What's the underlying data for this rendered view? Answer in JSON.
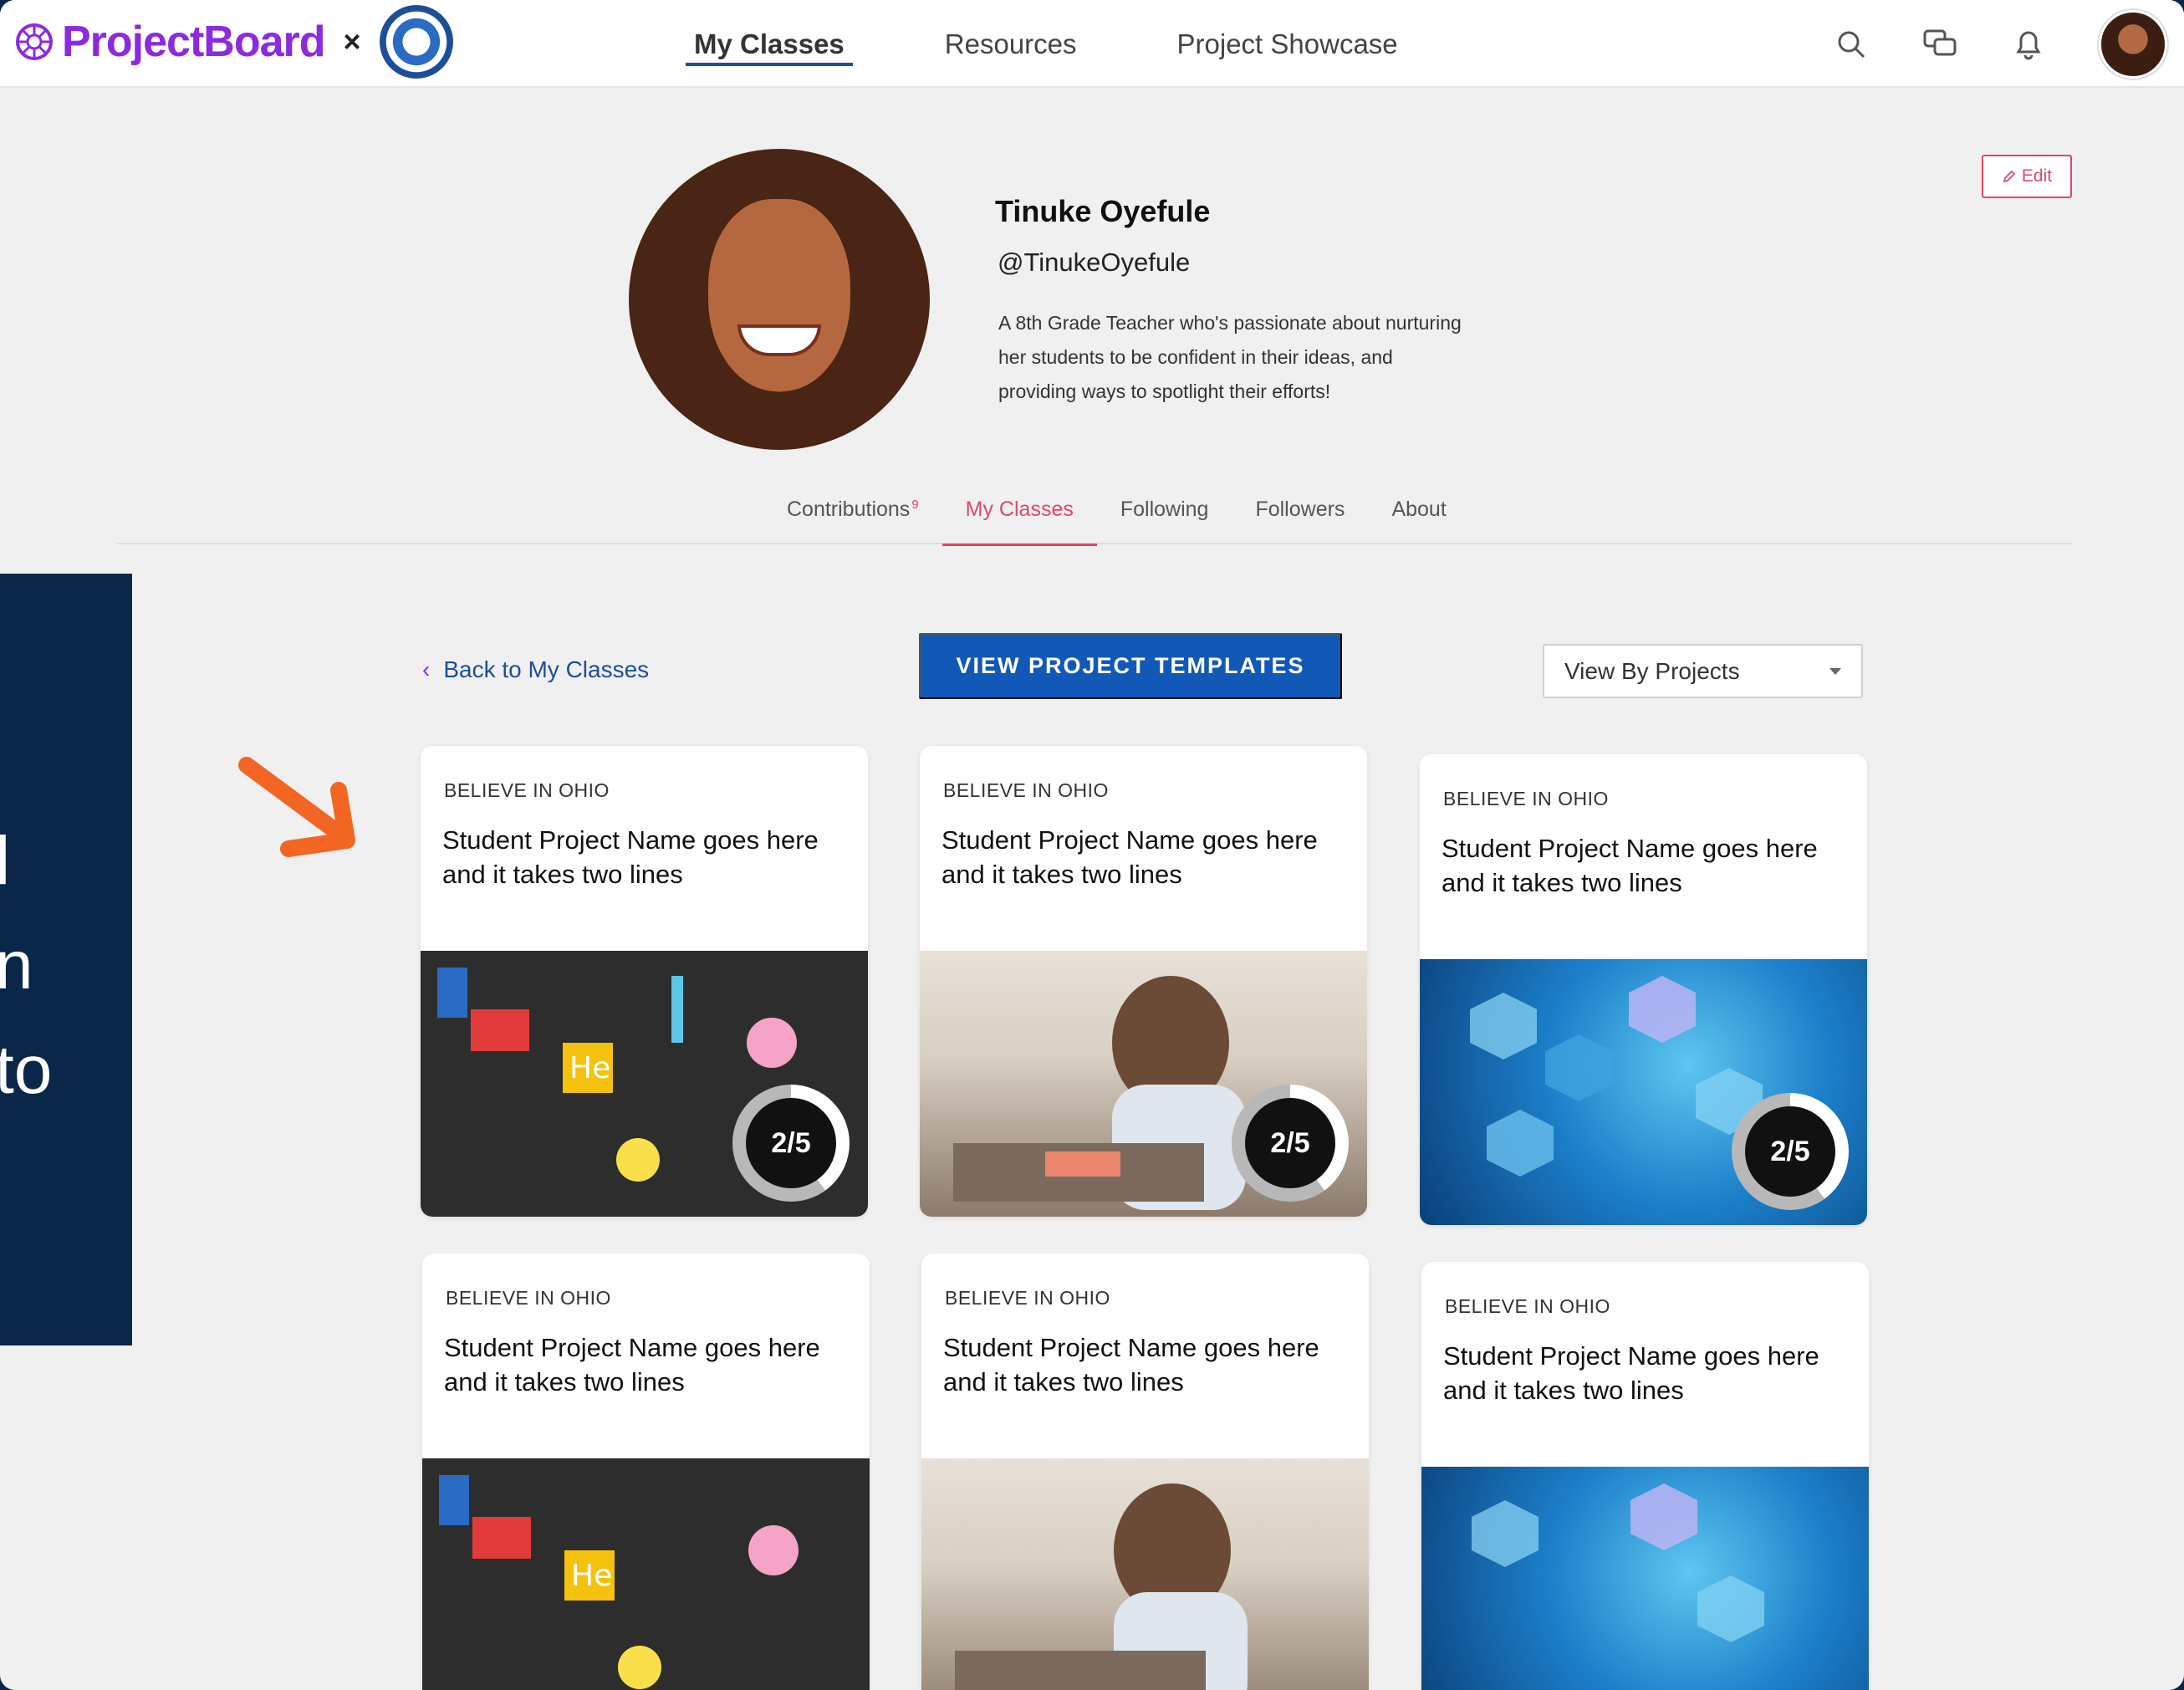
{
  "brand": {
    "name": "ProjectBoard",
    "separator": "×"
  },
  "nav": {
    "links": [
      {
        "label": "My Classes",
        "active": true
      },
      {
        "label": "Resources",
        "active": false
      },
      {
        "label": "Project Showcase",
        "active": false
      }
    ],
    "icons": [
      "search-icon",
      "chat-icon",
      "bell-icon"
    ]
  },
  "profile": {
    "name": "Tinuke Oyefule",
    "handle": "@TinukeOyefule",
    "bio": [
      "A 8th Grade Teacher who's passionate about nurturing",
      "her students to be confident in their ideas, and",
      "providing ways to spotlight their efforts!"
    ],
    "edit_label": "Edit"
  },
  "tabs": [
    {
      "label": "Contributions",
      "badge": "9",
      "active": false
    },
    {
      "label": "My Classes",
      "badge": "",
      "active": true
    },
    {
      "label": "Following",
      "badge": "",
      "active": false
    },
    {
      "label": "Followers",
      "badge": "",
      "active": false
    },
    {
      "label": "About",
      "badge": "",
      "active": false
    }
  ],
  "controls": {
    "back_label": "Back to My Classes",
    "templates_label": "VIEW PROJECT TEMPLATES",
    "view_select": "View By Projects"
  },
  "cards": [
    {
      "category": "BELIEVE IN OHIO",
      "title": "Student Project Name goes here and it takes two lines",
      "progress": "2/5",
      "image": "science-icons"
    },
    {
      "category": "BELIEVE IN OHIO",
      "title": "Student Project Name goes here and it takes two lines",
      "progress": "2/5",
      "image": "girl-soldering"
    },
    {
      "category": "BELIEVE IN OHIO",
      "title": "Student Project Name goes here and it takes two lines",
      "progress": "2/5",
      "image": "blue-hexagons"
    },
    {
      "category": "BELIEVE IN OHIO",
      "title": "Student Project Name goes here and it takes two lines",
      "progress": "",
      "image": "science-icons"
    },
    {
      "category": "BELIEVE IN OHIO",
      "title": "Student Project Name goes here and it takes two lines",
      "progress": "",
      "image": "girl-soldering"
    },
    {
      "category": "BELIEVE IN OHIO",
      "title": "Student Project Name goes here and it takes two lines",
      "progress": "",
      "image": "blue-hexagons"
    }
  ],
  "side_panel": {
    "lines": [
      "l",
      "n",
      "to"
    ]
  },
  "colors": {
    "brand": "#8a2be2",
    "accent": "#e0476a",
    "primary": "#1259b7",
    "panel": "#0a2648",
    "arrow": "#f26522"
  }
}
